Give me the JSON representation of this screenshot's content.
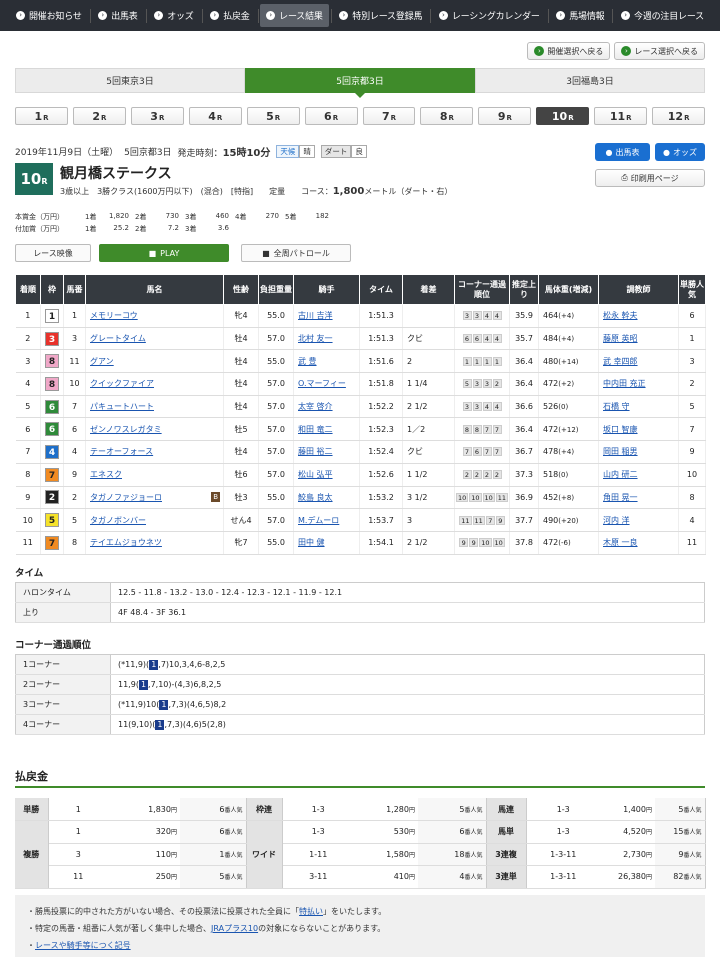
{
  "gnav": [
    {
      "label": "開催お知らせ",
      "active": false
    },
    {
      "label": "出馬表",
      "active": false
    },
    {
      "label": "オッズ",
      "active": false
    },
    {
      "label": "払戻金",
      "active": false
    },
    {
      "label": "レース結果",
      "active": true
    },
    {
      "label": "特別レース登録馬",
      "active": false
    },
    {
      "label": "レーシングカレンダー",
      "active": false
    },
    {
      "label": "馬場情報",
      "active": false
    },
    {
      "label": "今週の注目レース",
      "active": false
    }
  ],
  "top_buttons": [
    "開催選択へ戻る",
    "レース選択へ戻る"
  ],
  "meeting_tabs": [
    {
      "label": "5回東京3日",
      "active": false
    },
    {
      "label": "5回京都3日",
      "active": true
    },
    {
      "label": "3回福島3日",
      "active": false
    }
  ],
  "race_tabs": [
    "1",
    "2",
    "3",
    "4",
    "5",
    "6",
    "7",
    "8",
    "9",
    "10",
    "11",
    "12"
  ],
  "race_tab_suffix": "R",
  "race_tab_active_index": 9,
  "race": {
    "date": "2019年11月9日（土曜）",
    "meeting": "5回京都3日",
    "start_label": "発走時刻：",
    "start_time": "15時10分",
    "weather_label": "天候",
    "weather": "晴",
    "track_label": "ダート",
    "condition": "良",
    "num": "10",
    "num_suffix": "R",
    "name": "観月橋ステークス",
    "conditions_text": "3歳以上　3勝クラス(1600万円以下)　(混合)　[特指]　　定量　　コース：",
    "distance": "1,800",
    "unit": "メートル",
    "course": "（ダート・右）"
  },
  "buttons": {
    "entry": "出馬表",
    "odds": "オッズ",
    "print": "印刷用ページ",
    "video": "レース映像",
    "play": "PLAY",
    "patrol": "全周パトロール"
  },
  "prize": {
    "label": "本賞金（万円）",
    "items": [
      "1着",
      "1,820",
      "2着",
      "730",
      "3着",
      "460",
      "4着",
      "270",
      "5着",
      "182"
    ]
  },
  "addprize": {
    "label": "付加賞（万円）",
    "items": [
      "1着",
      "25.2",
      "2着",
      "7.2",
      "3着",
      "3.6"
    ]
  },
  "result_headers": [
    "着順",
    "枠",
    "馬番",
    "馬名",
    "性齢",
    "負担重量",
    "騎手",
    "タイム",
    "着差",
    "コーナー通過順位",
    "推定上り",
    "馬体重(増減)",
    "調教師",
    "単勝人気"
  ],
  "results": [
    {
      "pos": "1",
      "waku": "1",
      "num": "1",
      "horse": "メモリーコウ",
      "blinker": "",
      "sex": "牝4",
      "wt": "55.0",
      "jockey": "古川 吉洋",
      "time": "1:51.3",
      "margin": "",
      "corner": [
        "3",
        "3",
        "4",
        "4"
      ],
      "last": "35.9",
      "bw": "464",
      "bwd": "(+4)",
      "trainer": "松永 幹夫",
      "pop": "6"
    },
    {
      "pos": "2",
      "waku": "3",
      "num": "3",
      "horse": "グレートタイム",
      "blinker": "",
      "sex": "牡4",
      "wt": "57.0",
      "jockey": "北村 友一",
      "time": "1:51.3",
      "margin": "クビ",
      "corner": [
        "6",
        "6",
        "4",
        "4"
      ],
      "last": "35.7",
      "bw": "484",
      "bwd": "(+4)",
      "trainer": "藤原 英昭",
      "pop": "1"
    },
    {
      "pos": "3",
      "waku": "8",
      "num": "11",
      "horse": "グアン",
      "blinker": "",
      "sex": "牡4",
      "wt": "55.0",
      "jockey": "武 豊",
      "time": "1:51.6",
      "margin": "2",
      "corner": [
        "1",
        "1",
        "1",
        "1"
      ],
      "last": "36.4",
      "bw": "480",
      "bwd": "(+14)",
      "trainer": "武 幸四郎",
      "pop": "3"
    },
    {
      "pos": "4",
      "waku": "8",
      "num": "10",
      "horse": "クイックファイア",
      "blinker": "",
      "sex": "牡4",
      "wt": "57.0",
      "jockey": "O.マーフィー",
      "time": "1:51.8",
      "margin": "1 1/4",
      "corner": [
        "5",
        "3",
        "3",
        "2"
      ],
      "last": "36.4",
      "bw": "472",
      "bwd": "(+2)",
      "trainer": "中内田 充正",
      "pop": "2"
    },
    {
      "pos": "5",
      "waku": "6",
      "num": "7",
      "horse": "パキュートハート",
      "blinker": "",
      "sex": "牡4",
      "wt": "57.0",
      "jockey": "太宰 啓介",
      "time": "1:52.2",
      "margin": "2 1/2",
      "corner": [
        "3",
        "3",
        "4",
        "4"
      ],
      "last": "36.6",
      "bw": "526",
      "bwd": "(0)",
      "trainer": "石橋 守",
      "pop": "5"
    },
    {
      "pos": "6",
      "waku": "6",
      "num": "6",
      "horse": "ゼンノワスレガタミ",
      "blinker": "",
      "sex": "牡5",
      "wt": "57.0",
      "jockey": "和田 竜二",
      "time": "1:52.3",
      "margin": "1／2",
      "corner": [
        "8",
        "8",
        "7",
        "7"
      ],
      "last": "36.4",
      "bw": "472",
      "bwd": "(+12)",
      "trainer": "坂口 智康",
      "pop": "7"
    },
    {
      "pos": "7",
      "waku": "4",
      "num": "4",
      "horse": "テーオーフォース",
      "blinker": "",
      "sex": "牡4",
      "wt": "57.0",
      "jockey": "藤田 裕二",
      "time": "1:52.4",
      "margin": "クビ",
      "corner": [
        "7",
        "6",
        "7",
        "7"
      ],
      "last": "36.7",
      "bw": "478",
      "bwd": "(+4)",
      "trainer": "岡田 稲男",
      "pop": "9"
    },
    {
      "pos": "8",
      "waku": "7",
      "num": "9",
      "horse": "エネスク",
      "blinker": "",
      "sex": "牡6",
      "wt": "57.0",
      "jockey": "松山 弘平",
      "time": "1:52.6",
      "margin": "1 1/2",
      "corner": [
        "2",
        "2",
        "2",
        "2"
      ],
      "last": "37.3",
      "bw": "518",
      "bwd": "(0)",
      "trainer": "山内 研二",
      "pop": "10"
    },
    {
      "pos": "9",
      "waku": "2",
      "num": "2",
      "horse": "タガノファジョーロ",
      "blinker": "B",
      "sex": "牡3",
      "wt": "55.0",
      "jockey": "鮫島 良太",
      "time": "1:53.2",
      "margin": "3 1/2",
      "corner": [
        "10",
        "10",
        "10",
        "11"
      ],
      "last": "36.9",
      "bw": "452",
      "bwd": "(+8)",
      "trainer": "角田 晃一",
      "pop": "8"
    },
    {
      "pos": "10",
      "waku": "5",
      "num": "5",
      "horse": "タガノボンバー",
      "blinker": "",
      "sex": "せん4",
      "wt": "57.0",
      "jockey": "M.デムーロ",
      "time": "1:53.7",
      "margin": "3",
      "corner": [
        "11",
        "11",
        "7",
        "9"
      ],
      "last": "37.7",
      "bw": "490",
      "bwd": "(+20)",
      "trainer": "河内 洋",
      "pop": "4"
    },
    {
      "pos": "11",
      "waku": "7",
      "num": "8",
      "horse": "テイエムジョウネツ",
      "blinker": "",
      "sex": "牝7",
      "wt": "55.0",
      "jockey": "田中 健",
      "time": "1:54.1",
      "margin": "2 1/2",
      "corner": [
        "9",
        "9",
        "10",
        "10"
      ],
      "last": "37.8",
      "bw": "472",
      "bwd": "(-6)",
      "trainer": "木原 一良",
      "pop": "11"
    }
  ],
  "waku_colors": {
    "1": [
      "#ffffff",
      "#222"
    ],
    "2": [
      "#222222",
      "#fff"
    ],
    "3": [
      "#e8322b",
      "#fff"
    ],
    "4": [
      "#1e6fc9",
      "#fff"
    ],
    "5": [
      "#f5e22a",
      "#222"
    ],
    "6": [
      "#2f8a3a",
      "#fff"
    ],
    "7": [
      "#f18b22",
      "#222"
    ],
    "8": [
      "#f0a8c8",
      "#222"
    ]
  },
  "time_section": {
    "title": "タイム",
    "rows": [
      {
        "k": "ハロンタイム",
        "v": "12.5 - 11.8 - 13.2 - 13.0 - 12.4 - 12.3 - 12.1 - 11.9 - 12.1"
      },
      {
        "k": "上り",
        "v": "4F 48.4 - 3F 36.1"
      }
    ]
  },
  "corner_section": {
    "title": "コーナー通過順位",
    "rows": [
      {
        "k": "1コーナー",
        "pre": "(*11,9)(",
        "hl": "1",
        "post": ",7)10,3,4,6-8,2,5"
      },
      {
        "k": "2コーナー",
        "pre": "11,9(",
        "hl": "1",
        "post": ",7,10)-(4,3)6,8,2,5"
      },
      {
        "k": "3コーナー",
        "pre": "(*11,9)10(",
        "hl": "1",
        "post": ",7,3)(4,6,5)8,2"
      },
      {
        "k": "4コーナー",
        "pre": "11(9,10)(",
        "hl": "1",
        "post": ",7,3)(4,6)5(2,8)"
      }
    ]
  },
  "payout_title": "払戻金",
  "payout": {
    "yen": "円",
    "pop_suffix": "番人気",
    "tansho": {
      "label": "単勝",
      "rows": [
        {
          "num": "1",
          "amt": "1,830",
          "pop": "6"
        }
      ]
    },
    "fukusho": {
      "label": "複勝",
      "rows": [
        {
          "num": "1",
          "amt": "320",
          "pop": "6"
        },
        {
          "num": "3",
          "amt": "110",
          "pop": "1"
        },
        {
          "num": "11",
          "amt": "250",
          "pop": "5"
        }
      ]
    },
    "wakuren": {
      "label": "枠連",
      "rows": [
        {
          "num": "1-3",
          "amt": "1,280",
          "pop": "5"
        }
      ]
    },
    "wide": {
      "label": "ワイド",
      "rows": [
        {
          "num": "1-3",
          "amt": "530",
          "pop": "6"
        },
        {
          "num": "1-11",
          "amt": "1,580",
          "pop": "18"
        },
        {
          "num": "3-11",
          "amt": "410",
          "pop": "4"
        }
      ]
    },
    "umaren": {
      "label": "馬連",
      "rows": [
        {
          "num": "1-3",
          "amt": "1,400",
          "pop": "5"
        }
      ]
    },
    "umatan": {
      "label": "馬単",
      "rows": [
        {
          "num": "1-3",
          "amt": "4,520",
          "pop": "15"
        }
      ]
    },
    "sanrenpuku": {
      "label": "3連複",
      "rows": [
        {
          "num": "1-3-11",
          "amt": "2,730",
          "pop": "9"
        }
      ]
    },
    "sanrentan": {
      "label": "3連単",
      "rows": [
        {
          "num": "1-3-11",
          "amt": "26,380",
          "pop": "82"
        }
      ]
    }
  },
  "notes": [
    {
      "pre": "勝馬投票に的中された方がいない場合、その投票法に投票された全員に「",
      "link": "特払い",
      "post": "」をいたします。"
    },
    {
      "pre": "特定の馬番・組番に人気が著しく集中した場合、",
      "link": "JRAプラス10",
      "post": "の対象にならないことがあります。"
    },
    {
      "pre": "",
      "link": "レースや騎手等につく記号",
      "post": ""
    }
  ],
  "colors": {
    "accent": "#3f8b2a",
    "blue": "#1a6fd1",
    "header": "#353a40"
  }
}
